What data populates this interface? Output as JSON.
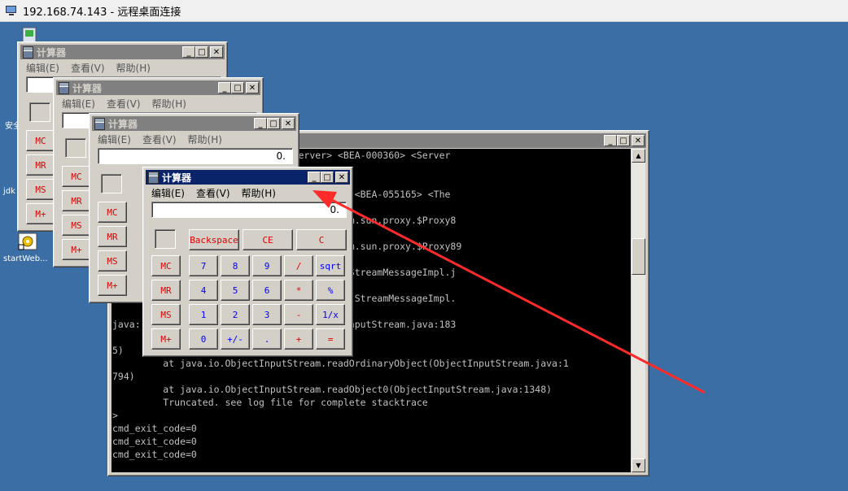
{
  "rdp": {
    "title": "192.168.74.143 - 远程桌面连接"
  },
  "desktop_icons": [
    {
      "label": "安全"
    },
    {
      "label": "jdk"
    },
    {
      "label": "startWeb..."
    }
  ],
  "calculator": {
    "title": "计算器",
    "menu": [
      "编辑(E)",
      "查看(V)",
      "帮助(H)"
    ],
    "display_value": "0.",
    "top_buttons": [
      "Backspace",
      "CE",
      "C"
    ],
    "memory_buttons": [
      "MC",
      "MR",
      "MS",
      "M+"
    ],
    "rows": [
      [
        "7",
        "8",
        "9",
        "/",
        "sqrt"
      ],
      [
        "4",
        "5",
        "6",
        "*",
        "%"
      ],
      [
        "1",
        "2",
        "3",
        "-",
        "1/x"
      ],
      [
        "0",
        "+/-",
        ".",
        "+",
        "="
      ]
    ]
  },
  "console": {
    "lines": [
      "                  ice> <WebLogicServer> <BEA-000360> <Server",
      "",
      "",
      "                  r> <JMSClientExceptions> <BEA-055165> <The",
      "",
      "                  eption: Invalid Type: com.sun.proxy.$Proxy8",
      "",
      "                  eption: Invalid Type: com.sun.proxy.$Proxy89",
      "",
      "                  MessageImpl.writeObject(StreamMessageImpl.j",
      "",
      "                  MessageImpl.readExternal(StreamMessageImpl.",
      "",
      "java:             readExternalData(ObjectInputStream.java:183",
      "",
      "5)",
      "         at java.io.ObjectInputStream.readOrdinaryObject(ObjectInputStream.java:1",
      "794)",
      "         at java.io.ObjectInputStream.readObject0(ObjectInputStream.java:1348)",
      "         Truncated. see log file for complete stacktrace",
      ">",
      "cmd_exit_code=0",
      "cmd_exit_code=0",
      "cmd_exit_code=0"
    ]
  },
  "colors": {
    "desktop": "#3a6ea5",
    "active_title": "#0a246a",
    "inactive_title": "#808080",
    "arrow": "#ff2a2a"
  }
}
